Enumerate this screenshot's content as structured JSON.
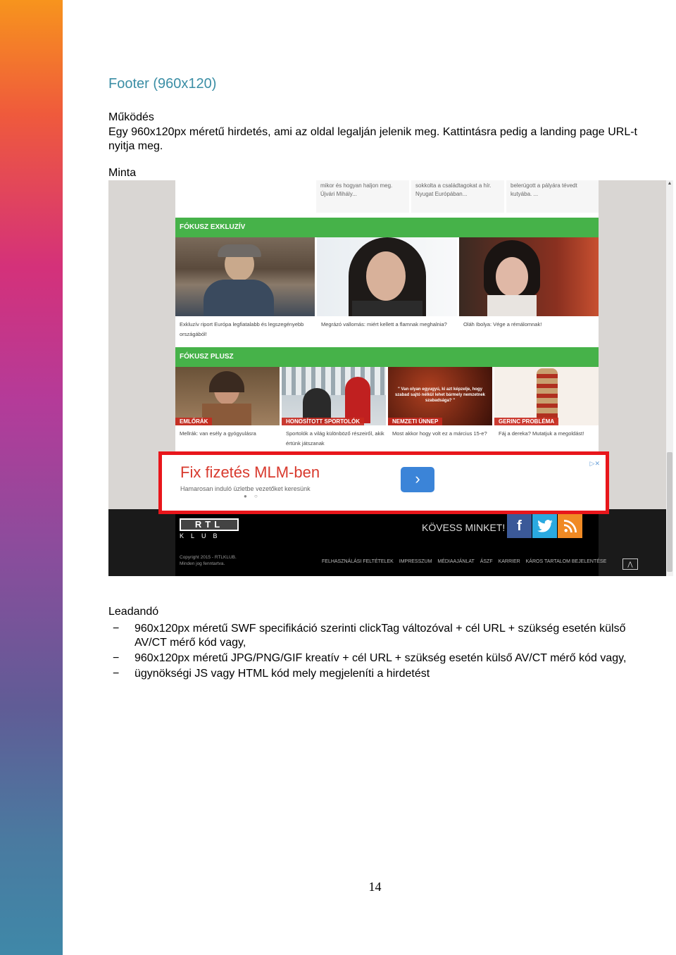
{
  "heading": "Footer (960x120)",
  "sections": {
    "mukodes_label": "Működés",
    "mukodes_text": "Egy 960x120px méretű hirdetés, ami az oldal legalján jelenik meg. Kattintásra pedig a landing page URL-t nyitja meg.",
    "minta_label": "Minta",
    "leadando_label": "Leadandó"
  },
  "screenshot": {
    "top_cards": [
      "mikor és hogyan haljon meg. Újvári Mihály...",
      "sokkolta a családtagokat a hír. Nyugat Európában...",
      "belerúgott a pályára tévedt kutyába. ..."
    ],
    "section1_title": "FÓKUSZ EXKLUZÍV",
    "section1_captions": [
      "Exkluzív riport Európa legfiatalabb és legszegényebb országából!",
      "Megrázó vallomás: miért kellett a flamnak meghalnia?",
      "Oláh Ibolya: Vége a rémálomnak!"
    ],
    "section2_title": "FÓKUSZ PLUSZ",
    "section2_tags": [
      "EMLŐRÁK",
      "HONOSÍTOTT SPORTOLÓK",
      "NEMZETI ÜNNEP",
      "GERINC PROBLÉMA"
    ],
    "section2_captions": [
      "Mellrák: van esély a gyógyulásra",
      "Sportolók a világ különböző részeiről, akik értünk játszanak",
      "Most akkor hogy volt ez a március 15-e?",
      "Fáj a dereka? Mutatjuk a megoldást!"
    ],
    "quote": "\" Van olyan egyugyú, ki azt képzelje, hogy szabad sajtó nélkül lehet bármely nemzetnek szabadsága? \"",
    "ad": {
      "title": "Fix fizetés MLM-ben",
      "subtitle": "Hamarosan induló üzletbe vezetőket keresünk",
      "button_glyph": "›",
      "close_glyph": "▷✕",
      "dots": "● ○"
    },
    "footer": {
      "logo_top": "RTL",
      "logo_bottom": "KLUB",
      "follow": "KÖVESS MINKET!",
      "social": [
        "f",
        "t",
        "rss"
      ],
      "copyright_line1": "Copyright 2015 - RTLKLUB.",
      "copyright_line2": "Minden jog fenntartva.",
      "links": [
        "FELHASZNÁLÁSI FELTÉTELEK",
        "IMPRESSZUM",
        "MÉDIAAJÁNLAT",
        "ÁSZF",
        "KARRIER",
        "KÁROS TARTALOM BEJELENTÉSE"
      ],
      "up_glyph": "⋀"
    }
  },
  "list": [
    "960x120px méretű SWF specifikáció szerinti clickTag változóval + cél URL + szükség esetén külső AV/CT mérő kód vagy,",
    "960x120px méretű JPG/PNG/GIF kreatív + cél URL + szükség esetén külső AV/CT mérő kód vagy,",
    "ügynökségi JS vagy HTML kód mely megjeleníti a hirdetést"
  ],
  "list_marker": "−",
  "page_number": "14",
  "colors": {
    "heading": "#3b8ea5",
    "green_bar": "#46b249",
    "ad_border": "#e8161b",
    "ad_title": "#d83a2e",
    "facebook": "#3b5998",
    "twitter": "#2aa9e0",
    "rss": "#f08a24"
  }
}
